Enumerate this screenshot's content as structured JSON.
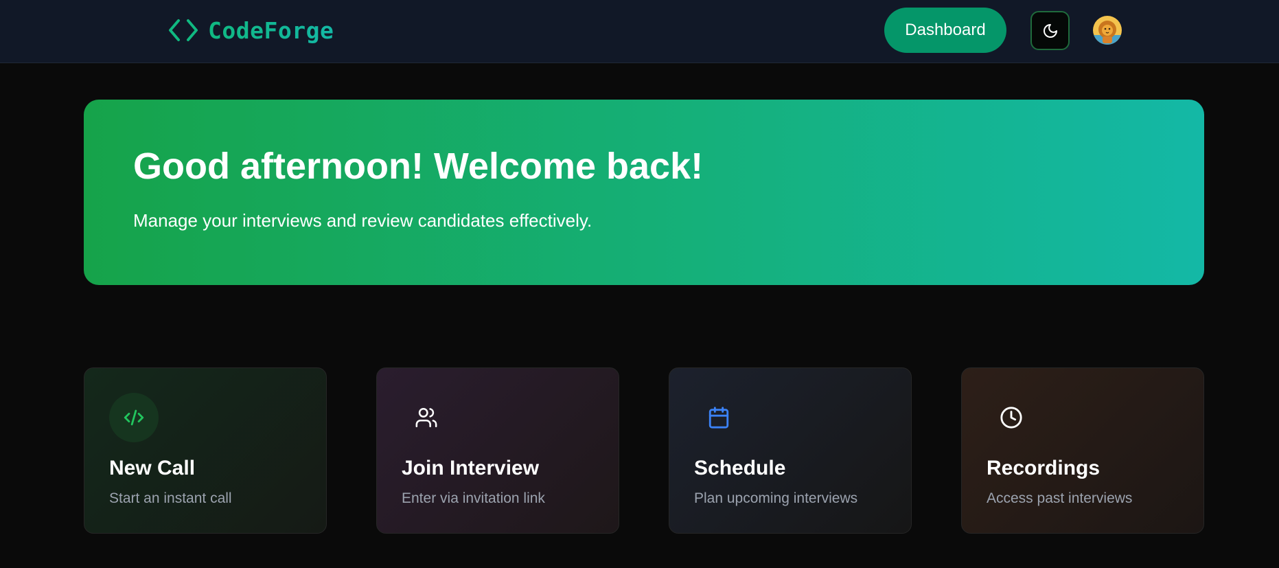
{
  "navbar": {
    "brand_name": "CodeForge",
    "brand_icon": "code-brackets-icon",
    "dashboard_label": "Dashboard",
    "theme_icon": "moon-icon",
    "avatar_icon": "user-avatar"
  },
  "hero": {
    "title": "Good afternoon! Welcome back!",
    "subtitle": "Manage your interviews and review candidates effectively."
  },
  "cards": [
    {
      "title": "New Call",
      "description": "Start an instant call",
      "icon": "code-icon",
      "accent": "#22c55e"
    },
    {
      "title": "Join Interview",
      "description": "Enter via invitation link",
      "icon": "users-icon",
      "accent": "#ffffff"
    },
    {
      "title": "Schedule",
      "description": "Plan upcoming interviews",
      "icon": "calendar-icon",
      "accent": "#3b82f6"
    },
    {
      "title": "Recordings",
      "description": "Access past interviews",
      "icon": "clock-icon",
      "accent": "#ffffff"
    }
  ],
  "colors": {
    "brand": "#10b981",
    "dashboard_button": "#059669",
    "hero_gradient_start": "#16a34a",
    "hero_gradient_end": "#14b8a6",
    "page_background": "#0a0a0a",
    "navbar_background": "#111827"
  }
}
